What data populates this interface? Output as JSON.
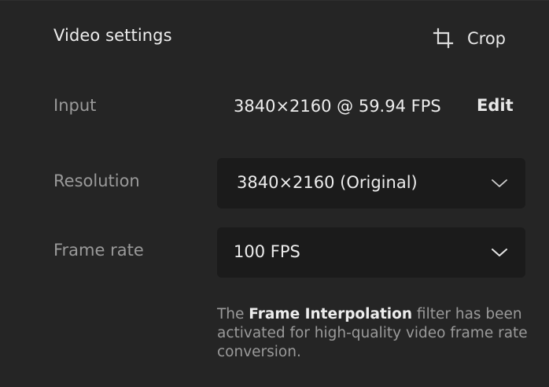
{
  "header": {
    "title": "Video settings",
    "crop_label": "Crop"
  },
  "input": {
    "label": "Input",
    "value": "3840×2160 @ 59.94 FPS",
    "edit_label": "Edit"
  },
  "resolution": {
    "label": "Resolution",
    "selected": "3840×2160 (Original)"
  },
  "frame_rate": {
    "label": "Frame rate",
    "selected": "100 FPS"
  },
  "note": {
    "prefix": "The ",
    "highlight": "Frame Interpolation",
    "suffix": " filter has been activated for high-quality video frame rate conversion."
  },
  "icons": {
    "crop": "crop-icon",
    "dropdown": "chevron-down-icon"
  },
  "colors": {
    "background": "#252525",
    "select_background": "#1b1b1b",
    "primary_text": "#ededed",
    "secondary_text": "#9a9a9a"
  }
}
